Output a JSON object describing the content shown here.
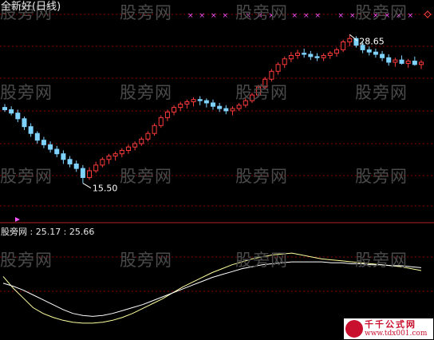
{
  "title": "全新好(日线)",
  "watermark": "股旁网",
  "indicator_label": "股旁网 : 25.17 : 25.66",
  "badge": {
    "line1": "千千公式网",
    "line2": "www.tdx001.com"
  },
  "colors": {
    "up": "#ff3b3b",
    "down": "#7fd4ff",
    "grid": "#8b0000",
    "marker": "#ff55ff",
    "line1": "#ffffa0",
    "line2": "#ffffff"
  },
  "chart_data": [
    {
      "type": "candlestick",
      "title": "全新好(日线)",
      "ylim": [
        12.5,
        31
      ],
      "annotations": [
        {
          "label": "28.65",
          "value": 28.65
        },
        {
          "label": "15.50",
          "value": 15.5
        }
      ],
      "candles": [
        [
          22.2,
          22.5,
          21.8,
          22.0
        ],
        [
          22.0,
          22.3,
          21.5,
          21.7
        ],
        [
          21.7,
          22.0,
          20.9,
          21.2
        ],
        [
          21.2,
          21.4,
          20.2,
          20.5
        ],
        [
          20.5,
          20.8,
          19.6,
          19.9
        ],
        [
          19.9,
          20.1,
          19.0,
          19.3
        ],
        [
          19.3,
          19.6,
          18.6,
          18.9
        ],
        [
          18.9,
          19.2,
          18.2,
          18.5
        ],
        [
          18.5,
          18.8,
          17.8,
          18.1
        ],
        [
          18.1,
          18.4,
          17.2,
          17.6
        ],
        [
          17.6,
          17.9,
          16.9,
          17.2
        ],
        [
          17.2,
          17.5,
          16.5,
          16.8
        ],
        [
          16.8,
          17.1,
          15.5,
          16.0
        ],
        [
          16.0,
          16.9,
          15.8,
          16.6
        ],
        [
          16.6,
          17.4,
          16.4,
          17.1
        ],
        [
          17.1,
          17.8,
          16.9,
          17.6
        ],
        [
          17.6,
          18.1,
          17.2,
          17.9
        ],
        [
          17.9,
          18.3,
          17.5,
          18.1
        ],
        [
          18.1,
          18.6,
          17.8,
          18.4
        ],
        [
          18.4,
          18.9,
          18.1,
          18.7
        ],
        [
          18.7,
          19.2,
          18.4,
          19.0
        ],
        [
          19.0,
          19.6,
          18.8,
          19.4
        ],
        [
          19.4,
          20.1,
          19.2,
          19.9
        ],
        [
          19.9,
          20.8,
          19.7,
          20.6
        ],
        [
          20.6,
          21.5,
          20.4,
          21.3
        ],
        [
          21.3,
          22.0,
          21.0,
          21.8
        ],
        [
          21.8,
          22.4,
          21.5,
          22.2
        ],
        [
          22.2,
          22.7,
          21.9,
          22.5
        ],
        [
          22.5,
          22.9,
          22.1,
          22.7
        ],
        [
          22.7,
          23.1,
          22.3,
          22.9
        ],
        [
          22.9,
          23.2,
          22.4,
          22.8
        ],
        [
          22.8,
          23.0,
          22.2,
          22.6
        ],
        [
          22.6,
          22.9,
          22.0,
          22.3
        ],
        [
          22.3,
          22.6,
          21.8,
          22.1
        ],
        [
          22.1,
          22.4,
          21.6,
          21.9
        ],
        [
          21.9,
          22.3,
          21.5,
          22.1
        ],
        [
          22.1,
          22.6,
          21.9,
          22.4
        ],
        [
          22.4,
          23.0,
          22.2,
          22.8
        ],
        [
          22.8,
          23.5,
          22.6,
          23.3
        ],
        [
          23.3,
          24.2,
          23.1,
          24.0
        ],
        [
          24.0,
          24.9,
          23.8,
          24.7
        ],
        [
          24.7,
          25.6,
          24.5,
          25.4
        ],
        [
          25.4,
          26.2,
          25.1,
          26.0
        ],
        [
          26.0,
          26.7,
          25.7,
          26.5
        ],
        [
          26.5,
          27.1,
          26.2,
          26.8
        ],
        [
          26.8,
          27.3,
          26.5,
          27.0
        ],
        [
          27.0,
          27.4,
          26.6,
          26.9
        ],
        [
          26.9,
          27.2,
          26.4,
          26.7
        ],
        [
          26.7,
          27.0,
          26.3,
          26.6
        ],
        [
          26.6,
          27.0,
          26.3,
          26.8
        ],
        [
          26.8,
          27.2,
          26.5,
          27.0
        ],
        [
          27.0,
          27.5,
          26.7,
          27.3
        ],
        [
          27.3,
          28.2,
          27.1,
          28.0
        ],
        [
          28.0,
          28.65,
          27.6,
          28.3
        ],
        [
          28.3,
          28.5,
          27.5,
          27.7
        ],
        [
          27.7,
          28.0,
          27.0,
          27.3
        ],
        [
          27.3,
          27.6,
          26.8,
          27.1
        ],
        [
          27.1,
          27.4,
          26.6,
          26.9
        ],
        [
          26.9,
          27.2,
          26.3,
          26.6
        ],
        [
          26.6,
          26.9,
          25.9,
          26.2
        ],
        [
          26.2,
          26.6,
          25.8,
          26.4
        ],
        [
          26.4,
          26.8,
          26.0,
          26.1
        ],
        [
          26.1,
          26.5,
          25.7,
          26.3
        ],
        [
          26.3,
          26.7,
          25.9,
          26.0
        ],
        [
          26.0,
          26.4,
          25.6,
          26.2
        ]
      ]
    },
    {
      "type": "line",
      "ylim": [
        0,
        100
      ],
      "series": [
        {
          "values": [
            62,
            50,
            40,
            30,
            24,
            20,
            17,
            15,
            14,
            14,
            15,
            17,
            20,
            24,
            29,
            34,
            39,
            45,
            51,
            56,
            61,
            66,
            70,
            74,
            77,
            80,
            82,
            84,
            85,
            86,
            84,
            82,
            80,
            79,
            78,
            77,
            76,
            75,
            74,
            73,
            72,
            70,
            68
          ]
        },
        {
          "values": [
            55,
            52,
            48,
            43,
            38,
            33,
            28,
            24,
            22,
            21,
            22,
            24,
            27,
            30,
            33,
            37,
            41,
            45,
            49,
            53,
            57,
            61,
            64,
            67,
            70,
            72,
            74,
            75,
            76,
            77,
            77,
            77,
            77,
            76,
            76,
            75,
            75,
            74,
            74,
            73,
            73,
            72,
            71
          ]
        }
      ]
    }
  ]
}
